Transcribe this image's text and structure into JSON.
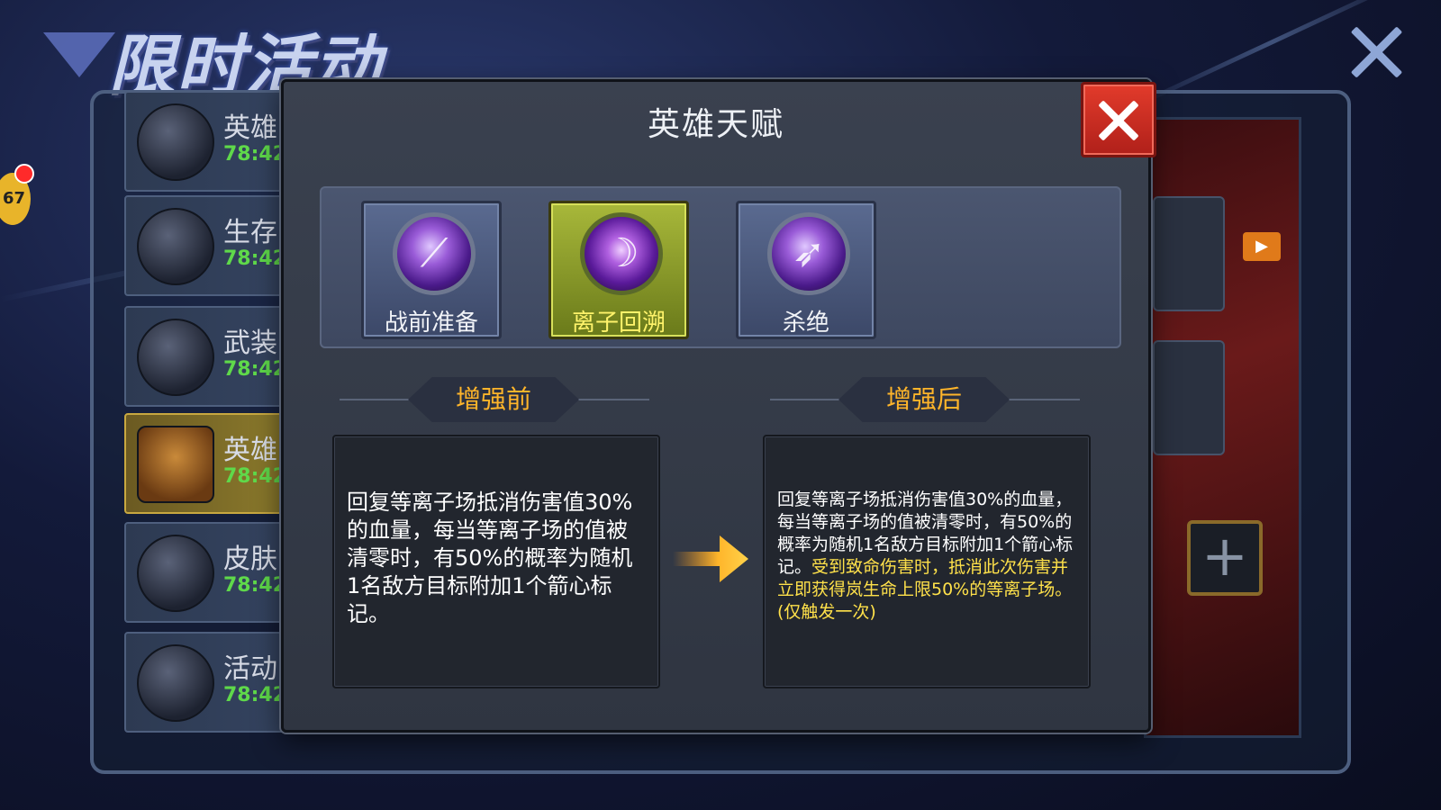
{
  "page": {
    "title": "限时活动",
    "badge_count": "67"
  },
  "sidebar": {
    "items": [
      {
        "label": "英雄",
        "time": "78:42",
        "icon": "revolver-icon"
      },
      {
        "label": "生存",
        "time": "78:42",
        "icon": "supply-crate-icon"
      },
      {
        "label": "武装",
        "time": "78:42",
        "icon": "drone-icon"
      },
      {
        "label": "英雄",
        "time": "78:42",
        "icon": "treasure-chest-icon"
      },
      {
        "label": "皮肤",
        "time": "78:42",
        "icon": "skin-chest-icon"
      },
      {
        "label": "活动",
        "time": "78:42",
        "icon": "megaphone-icon"
      }
    ]
  },
  "dialog": {
    "title": "英雄天赋",
    "talents": [
      {
        "name": "战前准备",
        "icon": "claw-slash-icon",
        "selected": false
      },
      {
        "name": "离子回溯",
        "icon": "hero-portrait-icon",
        "selected": true
      },
      {
        "name": "杀绝",
        "icon": "archer-icon",
        "selected": false
      }
    ],
    "before": {
      "heading": "增强前",
      "text": "回复等离子场抵消伤害值30%的血量，每当等离子场的值被清零时，有50%的概率为随机1名敌方目标附加1个箭心标记。"
    },
    "after": {
      "heading": "增强后",
      "text_normal": "回复等离子场抵消伤害值30%的血量，每当等离子场的值被清零时，有50%的概率为随机1名敌方目标附加1个箭心标记。",
      "text_highlight": "受到致命伤害时，抵消此次伤害并立即获得岚生命上限50%的等离子场。(仅触发一次)"
    }
  },
  "colors": {
    "highlight": "#ffe14a",
    "heading": "#ffb52a",
    "timer": "#5fd94a",
    "close_button": "#e23b2b",
    "selected_talent": "#a8b83a"
  }
}
